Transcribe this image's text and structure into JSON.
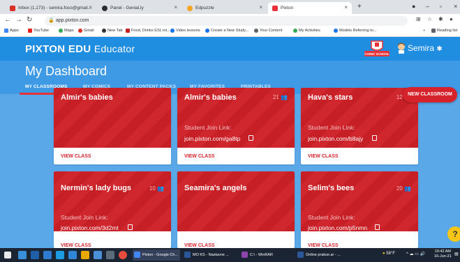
{
  "browser": {
    "tabs": [
      {
        "label": "Inbox (1,173) - semira.foco@gmail...",
        "icon": "gmail-icon",
        "color": "#d93025"
      },
      {
        "label": "Panel - Genial.ly",
        "icon": "genially-icon",
        "color": "#2d2d2d"
      },
      {
        "label": "Edpuzzle",
        "icon": "edpuzzle-icon",
        "color": "#f5a623"
      },
      {
        "label": "Pixton",
        "icon": "pixton-icon",
        "color": "#e8323a"
      }
    ],
    "new_tab": "+",
    "url": "app.pixton.com",
    "bookmarks": [
      {
        "label": "Apps",
        "color": "#4285f4"
      },
      {
        "label": "YouTube",
        "color": "#e62117"
      },
      {
        "label": "Maps",
        "color": "#34a853"
      },
      {
        "label": "Gmail",
        "color": "#d93025"
      },
      {
        "label": "New Tab",
        "color": "#333333"
      },
      {
        "label": "Food, Drinks ESL int...",
        "color": "#c5221f"
      },
      {
        "label": "Video lessons",
        "color": "#1a73e8"
      },
      {
        "label": "Create a New Study...",
        "color": "#1a73e8"
      },
      {
        "label": "Your Content",
        "color": "#5f6368"
      },
      {
        "label": "My Activities",
        "color": "#34a853"
      },
      {
        "label": "Models Referring to...",
        "color": "#1a73e8"
      },
      {
        "label": "»",
        "color": "#5f6368"
      },
      {
        "label": "Reading list",
        "color": "#5f6368"
      }
    ]
  },
  "header": {
    "brand": "PIXTON EDU",
    "sub": "Educator",
    "badge": "COMIC SCHOOL",
    "user": "Semira"
  },
  "dashboard": {
    "title": "My Dashboard",
    "tabs": [
      "MY CLASSROOMS",
      "MY COMICS",
      "MY CONTENT PACKS",
      "MY FAVORITES",
      "PRINTABLES"
    ],
    "new_classroom": "NEW CLASSROOM"
  },
  "cards": [
    {
      "name": "Almir's babies",
      "count": "",
      "join_label": "",
      "join_link": "",
      "view": "VIEW CLASS"
    },
    {
      "name": "Almir's babies",
      "count": "21",
      "join_label": "Student Join Link:",
      "join_link": "join.pixton.com/ga8tp",
      "view": "VIEW CLASS"
    },
    {
      "name": "Hava's stars",
      "count": "12",
      "join_label": "Student Join Link:",
      "join_link": "join.pixton.com/b8ajy",
      "view": "VIEW CLASS"
    },
    {
      "name": "Nermin's lady bugs",
      "count": "10",
      "join_label": "Student Join Link:",
      "join_link": "join.pixton.com/3d2mt",
      "view": "VIEW CLASS"
    },
    {
      "name": "Seamira's angels",
      "count": "",
      "join_label": "",
      "join_link": "",
      "view": "VIEW CLASS"
    },
    {
      "name": "Selim's bees",
      "count": "20",
      "join_label": "Student Join Link:",
      "join_link": "join.pixton.com/p5nmn",
      "view": "VIEW CLASS"
    }
  ],
  "help": "?",
  "taskbar": {
    "apps": [
      {
        "label": "Pixton - Google Ch...",
        "color": "#4285f4"
      },
      {
        "label": "MO KS - Nastavne ...",
        "color": "#2b579a"
      },
      {
        "label": "C:\\ - WinRAR",
        "color": "#8e44ad"
      },
      {
        "label": "Online prakse.ar - ...",
        "color": "#2b579a"
      }
    ],
    "weather": "58°F",
    "time": "10:42 AM",
    "date": "16-Jun-21"
  }
}
